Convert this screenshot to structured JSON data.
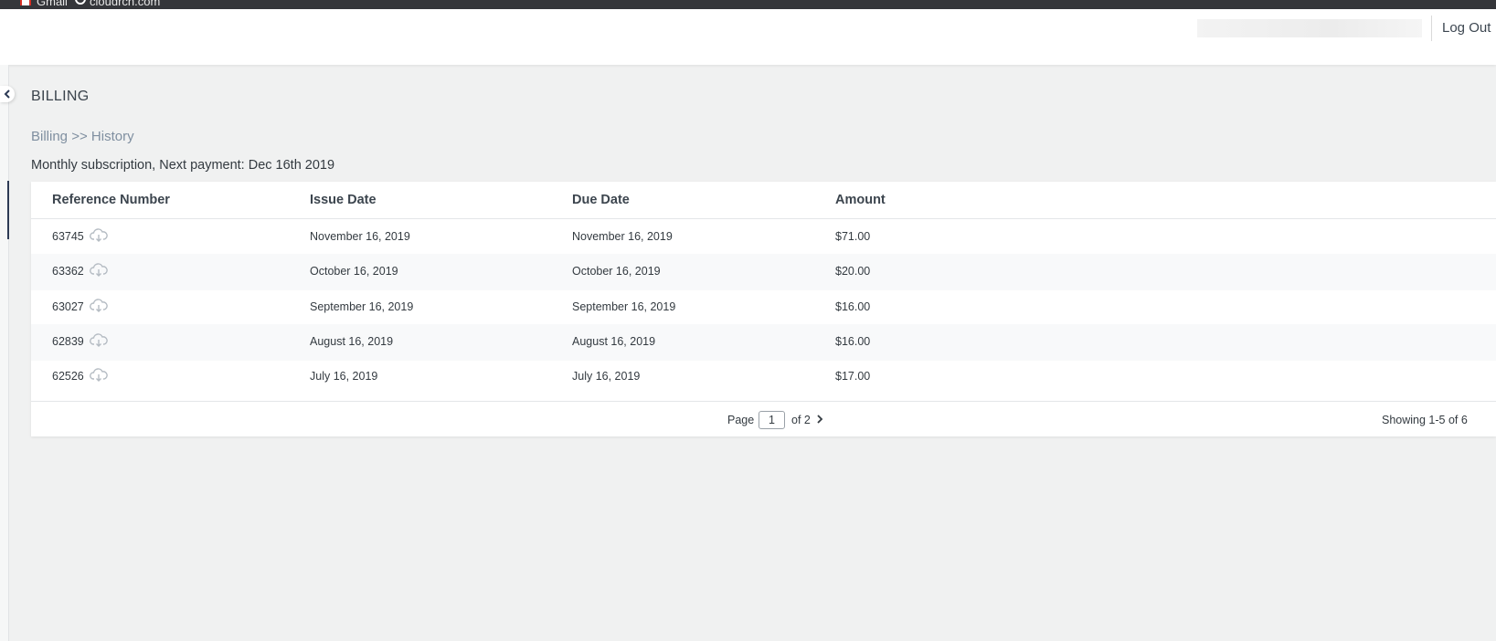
{
  "browser": {
    "bookmarks": [
      "Gmail",
      "cloudrch.com"
    ]
  },
  "header": {
    "logout_label": "Log Out"
  },
  "page": {
    "title": "BILLING",
    "breadcrumb": [
      "Billing",
      ">>",
      "History"
    ],
    "subscription_text": "Monthly subscription, Next payment: Dec 16th 2019"
  },
  "table": {
    "columns": [
      "Reference Number",
      "Issue Date",
      "Due Date",
      "Amount"
    ],
    "rows": [
      {
        "ref": "63745",
        "issue": "November 16, 2019",
        "due": "November 16, 2019",
        "amount": "$71.00"
      },
      {
        "ref": "63362",
        "issue": "October 16, 2019",
        "due": "October 16, 2019",
        "amount": "$20.00"
      },
      {
        "ref": "63027",
        "issue": "September 16, 2019",
        "due": "September 16, 2019",
        "amount": "$16.00"
      },
      {
        "ref": "62839",
        "issue": "August 16, 2019",
        "due": "August 16, 2019",
        "amount": "$16.00"
      },
      {
        "ref": "62526",
        "issue": "July 16, 2019",
        "due": "July 16, 2019",
        "amount": "$17.00"
      }
    ],
    "row_icon": "cloud-download-icon"
  },
  "pagination": {
    "page_label": "Page",
    "current_page": "1",
    "of_label": "of 2",
    "showing": "Showing 1-5 of 6"
  },
  "colors": {
    "background": "#f0f1f1",
    "card": "#ffffff",
    "breadcrumb": "#7f8fa0",
    "rail_accent": "#2c3a55"
  }
}
